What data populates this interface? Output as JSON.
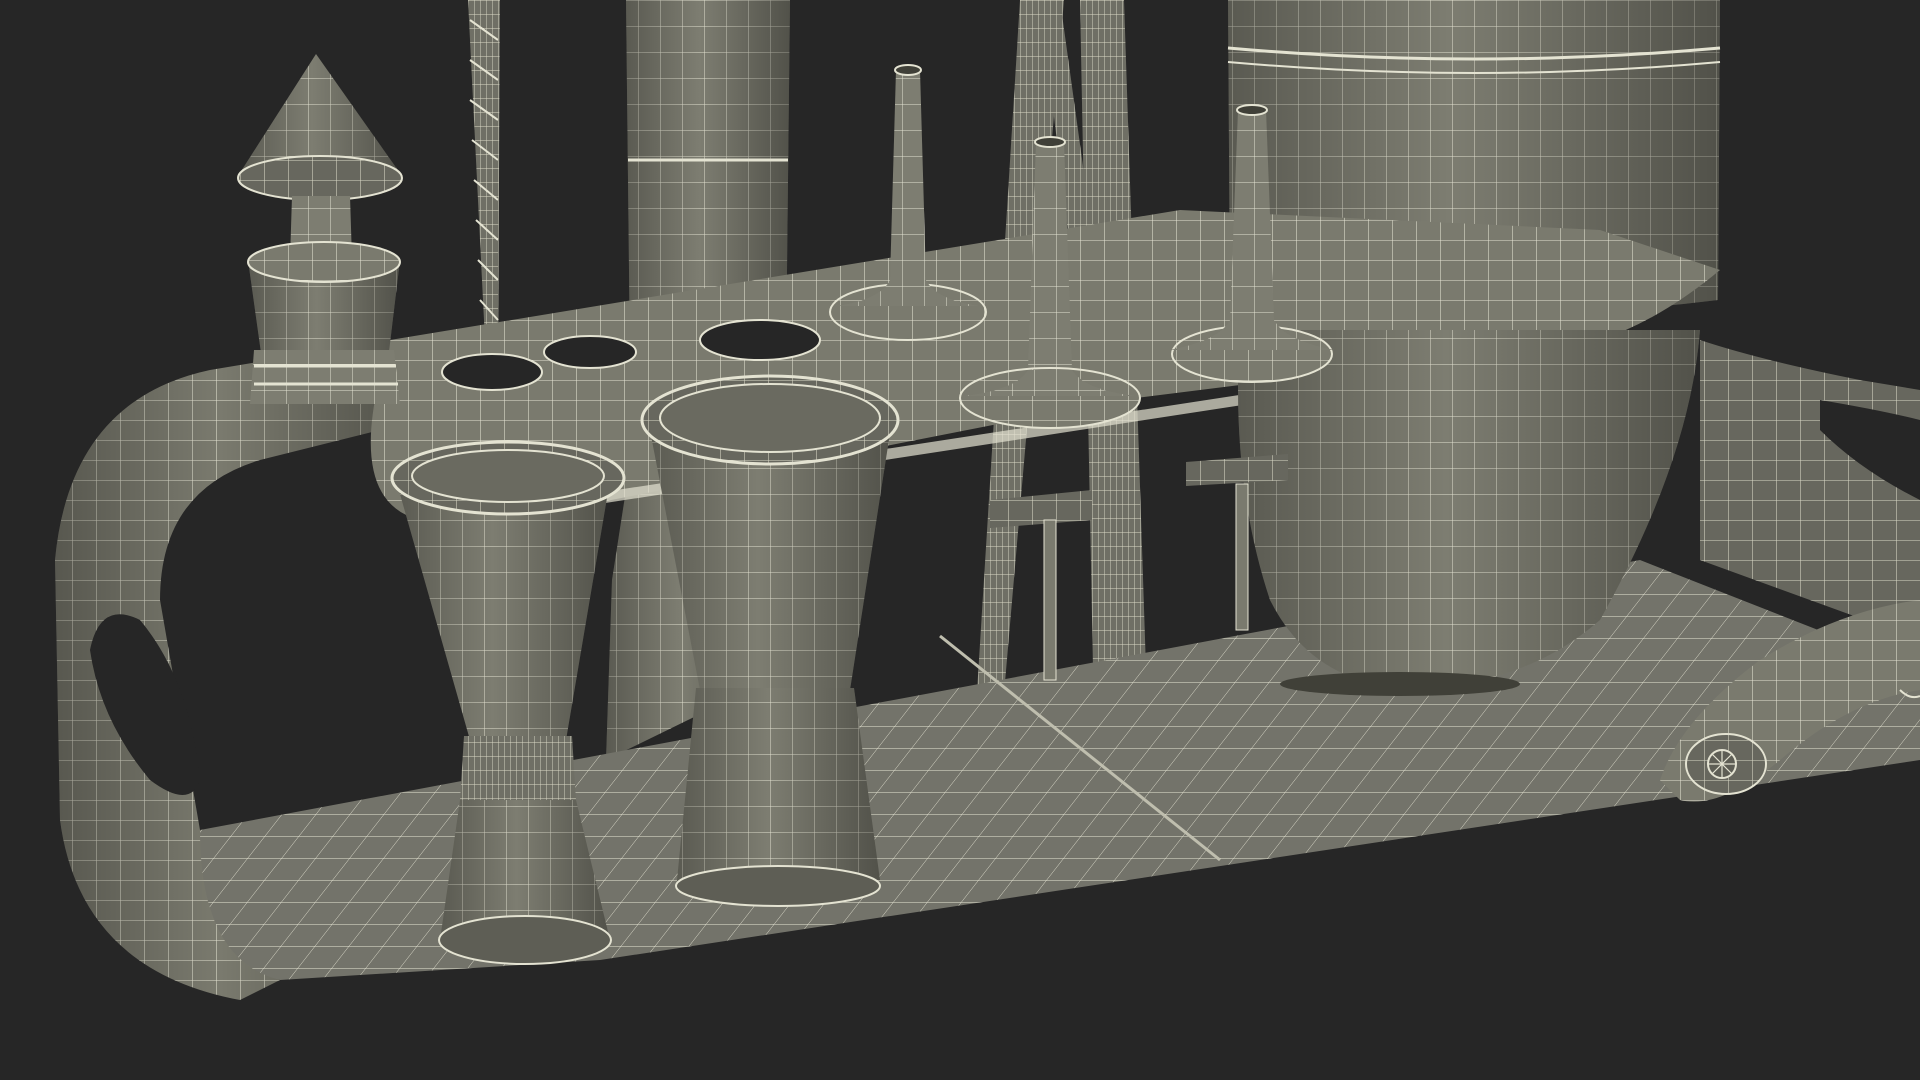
{
  "scene": {
    "subject": "bar-tool-set-wireframe-render",
    "colors": {
      "background": "#262626",
      "surface": "#7a7a6e",
      "surface_light": "#8c8c80",
      "surface_dark": "#5e5e55",
      "shadow": "#404038",
      "wire": "#e4e3d2"
    }
  }
}
